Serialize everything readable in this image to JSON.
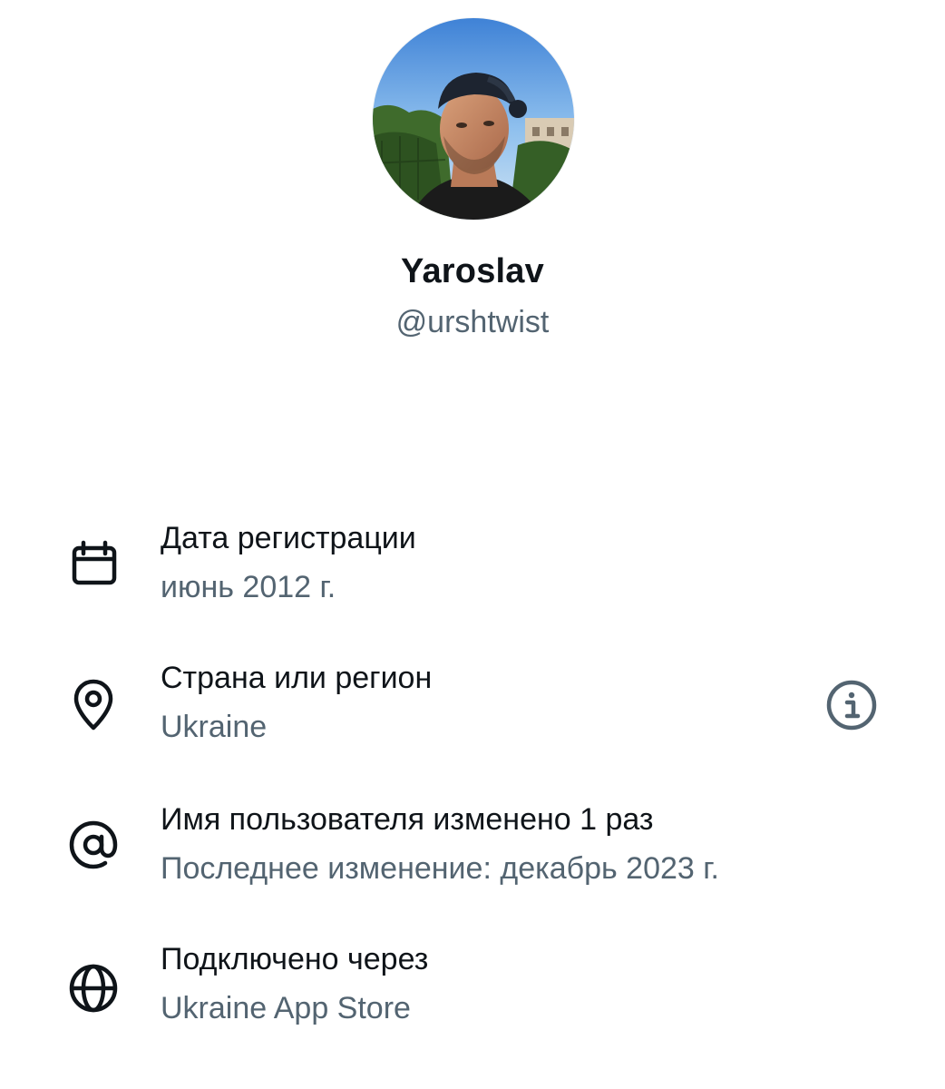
{
  "profile": {
    "display_name": "Yaroslav",
    "handle": "@urshtwist",
    "avatar_icon": "user-avatar-photo"
  },
  "about": [
    {
      "icon": "calendar-icon",
      "title": "Дата регистрации",
      "subtitle": "июнь 2012 г."
    },
    {
      "icon": "location-pin-icon",
      "title": "Страна или регион",
      "subtitle": "Ukraine",
      "action_icon": "info-icon"
    },
    {
      "icon": "at-sign-icon",
      "title": "Имя пользователя изменено 1 раз",
      "subtitle": "Последнее изменение: декабрь 2023 г."
    },
    {
      "icon": "globe-icon",
      "title": "Подключено через",
      "subtitle": "Ukraine App Store"
    }
  ],
  "colors": {
    "primary_text": "#0f1419",
    "secondary_text": "#536471",
    "background": "#ffffff"
  }
}
